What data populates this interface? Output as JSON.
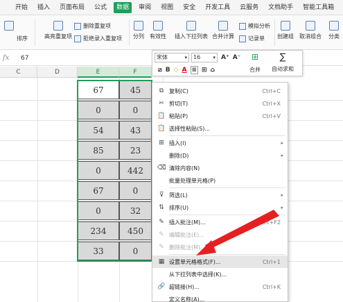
{
  "ribbon": {
    "tabs": [
      "开始",
      "插入",
      "页面布局",
      "公式",
      "数据",
      "审阅",
      "视图",
      "安全",
      "开发工具",
      "云服务",
      "文档助手",
      "智能工具箱"
    ],
    "active_tab": "数据",
    "sort_label": "排序",
    "highlight_dup": "高亮重复项",
    "remove_dup": "删除重复项",
    "reject_dup": "拒绝录入重复项",
    "split_label": "分列",
    "validity": "有效性",
    "insert_dropdown": "插入下拉列表",
    "merge_calc": "合并计算",
    "simulate": "模拟分析",
    "record": "记录单",
    "create_group": "创建组",
    "ungroup": "取消组合",
    "subtotal": "分类"
  },
  "formula_bar": {
    "fx": "fx",
    "value": "67"
  },
  "columns": [
    "C",
    "D",
    "E",
    "F"
  ],
  "cells": {
    "e": [
      "67",
      "0",
      "54",
      "85",
      "0",
      "67",
      "0",
      "234",
      "33"
    ],
    "f": [
      "45",
      "0",
      "43",
      "23",
      "442",
      "0",
      "32",
      "450",
      "0"
    ]
  },
  "mini_toolbar": {
    "font": "宋体",
    "size": "16",
    "grow": "A⁺",
    "shrink": "A⁻",
    "bold": "B",
    "font_color": "A",
    "merge": "合并",
    "autosum": "自动求和",
    "autosum_icon": "∑"
  },
  "context_menu": [
    {
      "label": "复制(C)",
      "shortcut": "Ctrl+C",
      "icon": "⧉"
    },
    {
      "label": "剪切(T)",
      "shortcut": "Ctrl+X",
      "icon": "✂"
    },
    {
      "label": "粘贴(P)",
      "shortcut": "Ctrl+V",
      "icon": "📋"
    },
    {
      "label": "选择性粘贴(S)...",
      "shortcut": "",
      "icon": "📋"
    },
    {
      "label": "插入(I)",
      "shortcut": "",
      "icon": "⊞"
    },
    {
      "label": "删除(D)",
      "shortcut": "",
      "icon": ""
    },
    {
      "label": "清除内容(N)",
      "shortcut": "",
      "icon": "⌫"
    },
    {
      "label": "批量处理单元格(P)",
      "shortcut": "",
      "icon": ""
    },
    {
      "label": "筛选(L)",
      "shortcut": "",
      "icon": "⊽"
    },
    {
      "label": "排序(U)",
      "shortcut": "",
      "icon": "⇅"
    },
    {
      "label": "插入批注(M)...",
      "shortcut": "Shift+F2",
      "icon": "✎"
    },
    {
      "label": "编辑批注(E)...",
      "shortcut": "",
      "icon": "✎"
    },
    {
      "label": "删除批注(M)",
      "shortcut": "",
      "icon": "✎"
    },
    {
      "label": "设置单元格格式(F)...",
      "shortcut": "Ctrl+1",
      "icon": "▦"
    },
    {
      "label": "从下拉列表中选择(K)...",
      "shortcut": "",
      "icon": ""
    },
    {
      "label": "超链接(H)...",
      "shortcut": "Ctrl+K",
      "icon": "🔗"
    },
    {
      "label": "定义名称(A)...",
      "shortcut": "",
      "icon": ""
    }
  ]
}
